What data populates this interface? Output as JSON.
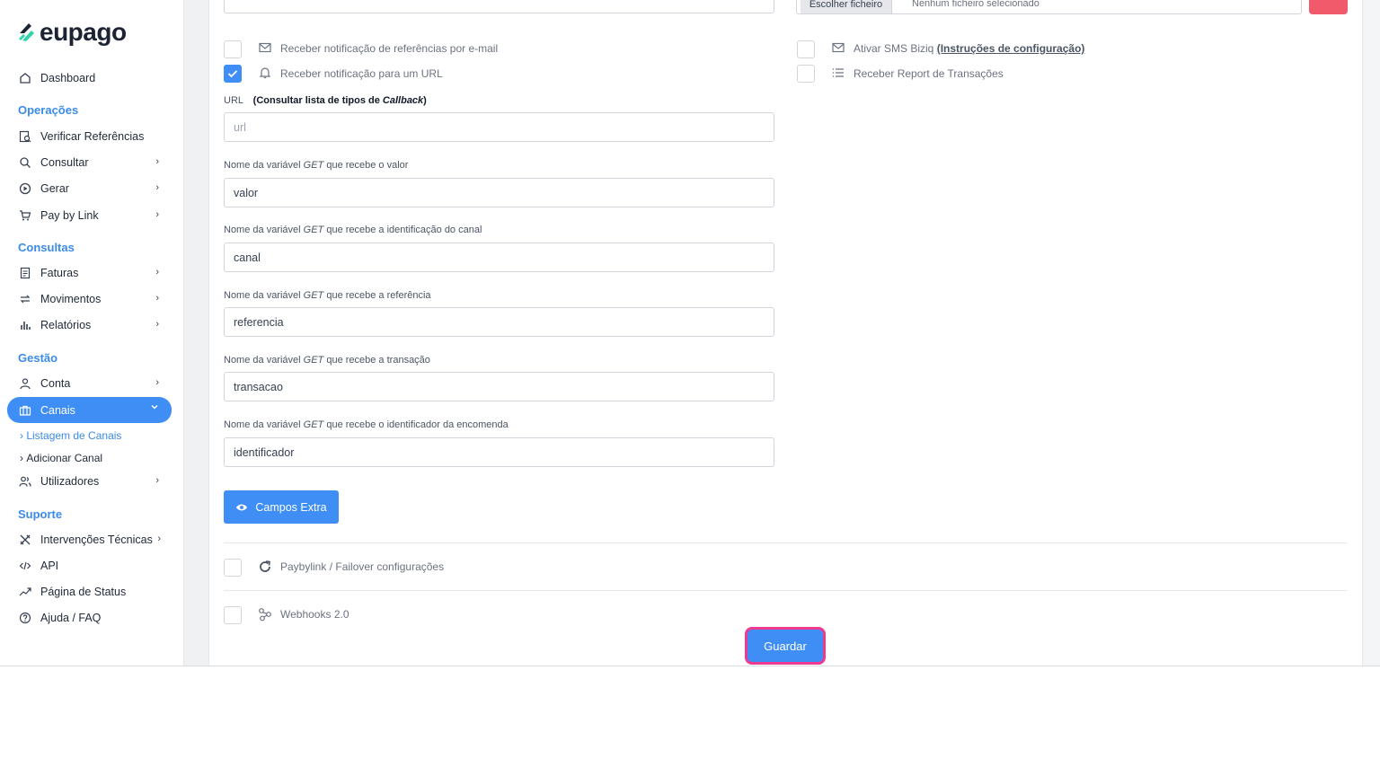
{
  "logo": {
    "text": "eupago"
  },
  "sidebar": {
    "dashboard": "Dashboard",
    "sections": {
      "operacoes": "Operações",
      "consultas": "Consultas",
      "gestao": "Gestão",
      "suporte": "Suporte"
    },
    "operacoes": [
      "Verificar Referências",
      "Consultar",
      "Gerar",
      "Pay by Link"
    ],
    "consultas": [
      "Faturas",
      "Movimentos",
      "Relatórios"
    ],
    "gestao": [
      "Conta",
      "Canais",
      "Utilizadores"
    ],
    "canais_sub": [
      "Listagem de Canais",
      "Adicionar Canal"
    ],
    "suporte": [
      "Intervenções Técnicas",
      "API",
      "Página de Status",
      "Ajuda / FAQ"
    ]
  },
  "top": {
    "file_button": "Escolher ficheiro",
    "file_text": "Nenhum ficheiro selecionado"
  },
  "options": {
    "email_notif": "Receber notificação de referências por e-mail",
    "url_notif": "Receber notificação para um URL",
    "sms_prefix": "Ativar SMS Biziq ",
    "sms_link": "(Instruções de configuração)",
    "report": "Receber Report de Transações",
    "paybylink": "Paybylink / Failover configurações",
    "webhooks": "Webhooks 2.0"
  },
  "form": {
    "url_label": "URL",
    "url_help_prefix": "(Consultar lista de tipos de ",
    "url_help_em": "Callback",
    "url_help_suffix": ")",
    "url_placeholder": "url",
    "label_prefix": "Nome da variável ",
    "label_get": "GET",
    "fields": [
      {
        "label_suffix": " que recebe o valor",
        "value": "valor"
      },
      {
        "label_suffix": " que recebe a identificação do canal",
        "value": "canal"
      },
      {
        "label_suffix": " que recebe a referência",
        "value": "referencia"
      },
      {
        "label_suffix": " que recebe a transação",
        "value": "transacao"
      },
      {
        "label_suffix": " que recebe o identificador da encomenda",
        "value": "identificador"
      }
    ]
  },
  "buttons": {
    "campos_extra": "Campos Extra",
    "guardar": "Guardar"
  },
  "colors": {
    "accent": "#3f8ef5",
    "section": "#3b8be8",
    "highlight": "#ec3a8f",
    "danger": "#f05a6b"
  }
}
